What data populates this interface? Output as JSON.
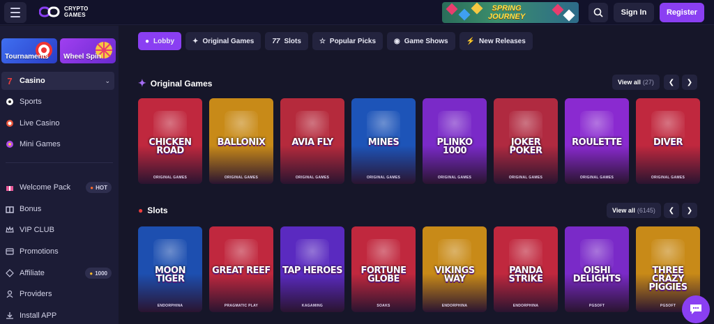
{
  "header": {
    "logo_line1": "CRYPTO",
    "logo_line2": "GAMES",
    "banner_line1": "SPRING",
    "banner_line2": "JOURNEY",
    "signin_label": "Sign In",
    "register_label": "Register",
    "accent_color": "#8a3ff2"
  },
  "sidebar": {
    "promos": [
      {
        "label": "Tournaments"
      },
      {
        "label": "Wheel Spin"
      }
    ],
    "casino_label": "Casino",
    "items": [
      {
        "label": "Sports",
        "icon": "soccer-ball-icon"
      },
      {
        "label": "Live Casino",
        "icon": "live-casino-icon"
      },
      {
        "label": "Mini Games",
        "icon": "mini-games-icon"
      },
      {
        "label": "Welcome Pack",
        "icon": "gift-icon",
        "badge": "HOT"
      },
      {
        "label": "Bonus",
        "icon": "bonus-icon"
      },
      {
        "label": "VIP CLUB",
        "icon": "crown-icon"
      },
      {
        "label": "Promotions",
        "icon": "promotions-icon"
      },
      {
        "label": "Affiliate",
        "icon": "affiliate-icon",
        "badge": "1000"
      },
      {
        "label": "Providers",
        "icon": "providers-icon"
      },
      {
        "label": "Install APP",
        "icon": "download-icon"
      }
    ]
  },
  "tabs": [
    {
      "label": "Lobby",
      "icon": "cherry-icon",
      "active": true
    },
    {
      "label": "Original Games",
      "icon": "sparkle-icon"
    },
    {
      "label": "Slots",
      "icon": "sevens-icon"
    },
    {
      "label": "Popular Picks",
      "icon": "star-icon"
    },
    {
      "label": "Game Shows",
      "icon": "wheel-icon"
    },
    {
      "label": "New Releases",
      "icon": "lightning-icon"
    }
  ],
  "original": {
    "title": "Original Games",
    "view_all": "View all",
    "count": "(27)",
    "games": [
      {
        "name": "CHICKEN ROAD",
        "provider": "ORIGINAL GAMES",
        "bg": "#c0283e"
      },
      {
        "name": "BALLONIX",
        "provider": "ORIGINAL GAMES",
        "bg": "#c88a18"
      },
      {
        "name": "AVIA FLY",
        "provider": "ORIGINAL GAMES",
        "bg": "#b52a3c"
      },
      {
        "name": "MINES",
        "provider": "ORIGINAL GAMES",
        "bg": "#1d54b8"
      },
      {
        "name": "PLINKO 1000",
        "provider": "ORIGINAL GAMES",
        "bg": "#7a2ac8"
      },
      {
        "name": "JOKER POKER",
        "provider": "ORIGINAL GAMES",
        "bg": "#b02a40"
      },
      {
        "name": "ROULETTE",
        "provider": "ORIGINAL GAMES",
        "bg": "#8a2ad0"
      },
      {
        "name": "DIVER",
        "provider": "ORIGINAL GAMES",
        "bg": "#c0283e"
      }
    ]
  },
  "slots": {
    "title": "Slots",
    "view_all": "View all",
    "count": "(6145)",
    "games": [
      {
        "name": "MOON TIGER",
        "provider": "ENDORPHINA",
        "bg": "#1d4fb0"
      },
      {
        "name": "GREAT REEF",
        "provider": "PRAGMATIC PLAY",
        "bg": "#c0283e"
      },
      {
        "name": "TAP HEROES",
        "provider": "KAGAMING",
        "bg": "#5a2ac0"
      },
      {
        "name": "FORTUNE GLOBE",
        "provider": "SOAKS",
        "bg": "#c0283e"
      },
      {
        "name": "VIKINGS WAY",
        "provider": "ENDORPHINA",
        "bg": "#c88a18"
      },
      {
        "name": "PANDA STRIKE",
        "provider": "ENDORPHINA",
        "bg": "#c0283e"
      },
      {
        "name": "OISHI DELIGHTS",
        "provider": "PGSOFT",
        "bg": "#7a2ac8"
      },
      {
        "name": "THREE CRAZY PIGGIES",
        "provider": "PGSOFT",
        "bg": "#c88a18"
      }
    ]
  }
}
